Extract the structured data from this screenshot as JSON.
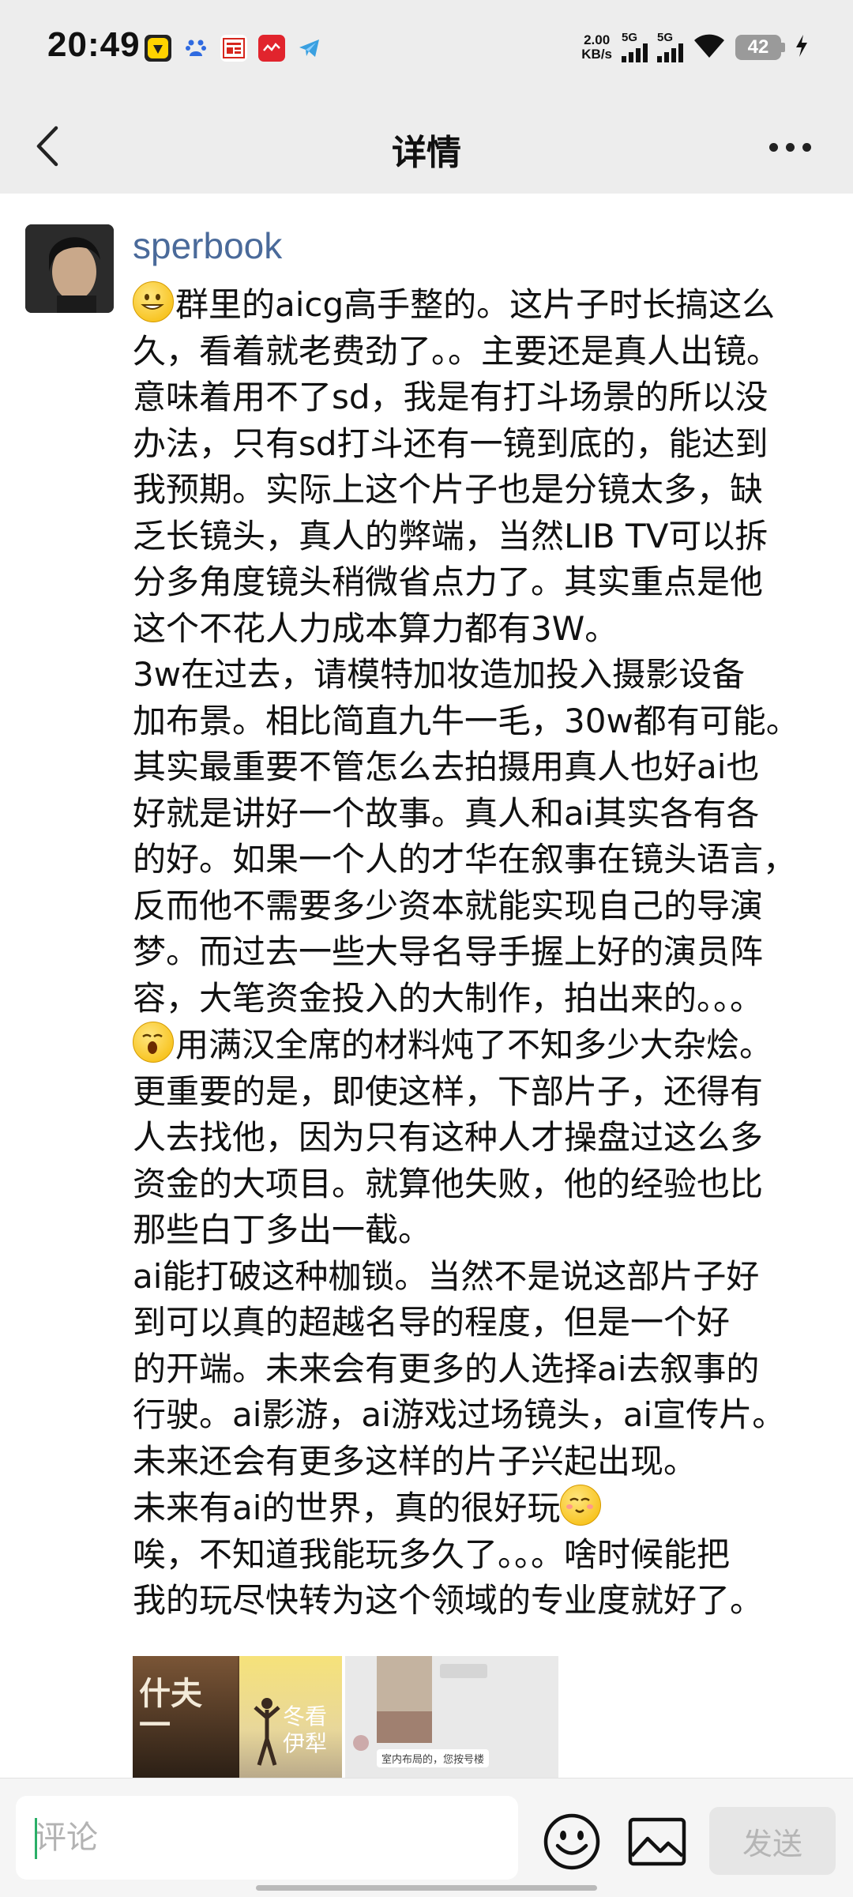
{
  "status_bar": {
    "time": "20:49",
    "net_speed_value": "2.00",
    "net_speed_unit": "KB/s",
    "sim1_label": "5G",
    "sim2_label": "5G",
    "battery_level": "42",
    "apps": [
      "qq-browser-icon",
      "baidu-icon",
      "toutiao-icon",
      "xiaohongshu-icon",
      "telegram-icon"
    ]
  },
  "nav": {
    "title": "详情",
    "back_icon": "chevron-left-icon",
    "more_icon": "more-dots-icon"
  },
  "post": {
    "author": "sperbook",
    "lines": [
      "群里的aicg高手整的。这片子时长搞这么",
      "久，看着就老费劲了。。主要还是真人出镜。",
      "意味着用不了sd，我是有打斗场景的所以没",
      "办法，只有sd打斗还有一镜到底的，能达到",
      "我预期。实际上这个片子也是分镜太多，缺",
      "乏长镜头，真人的弊端，当然LIB TV可以拆",
      "分多角度镜头稍微省点力了。其实重点是他",
      "这个不花人力成本算力都有3W。",
      "3w在过去，请模特加妆造加投入摄影设备",
      "加布景。相比简直九牛一毛，30w都有可能。",
      "其实最重要不管怎么去拍摄用真人也好ai也",
      "好就是讲好一个故事。真人和ai其实各有各",
      "的好。如果一个人的才华在叙事在镜头语言，",
      "反而他不需要多少资本就能实现自己的导演",
      "梦。而过去一些大导名导手握上好的演员阵",
      "容，大笔资金投入的大制作，拍出来的。。。",
      "用满汉全席的材料炖了不知多少大杂烩。",
      "更重要的是，即使这样，下部片子，还得有",
      "人去找他，因为只有这种人才操盘过这么多",
      "资金的大项目。就算他失败，他的经验也比",
      "那些白丁多出一截。",
      "ai能打破这种枷锁。当然不是说这部片子好",
      "到可以真的超越名导的程度，但是一个好",
      "的开端。未来会有更多的人选择ai去叙事的",
      "行驶。ai影游，ai游戏过场镜头，ai宣传片。",
      "未来还会有更多这样的片子兴起出现。",
      "未来有ai的世界，真的很好玩",
      "唉，不知道我能玩多久了。。。啥时候能把",
      "我的玩尽快转为这个领域的专业度就好了。"
    ],
    "emojis": [
      "grin-emoji",
      "yawn-emoji",
      "smile-emoji"
    ],
    "photo1_text": "什夫一",
    "photo2_text": "冬看 伊犁",
    "photo3_text": "室内布局的，您按号楼"
  },
  "bottom_bar": {
    "comment_placeholder": "评论",
    "send_label": "发送",
    "emoji_icon": "emoji-icon",
    "image_icon": "image-icon"
  }
}
